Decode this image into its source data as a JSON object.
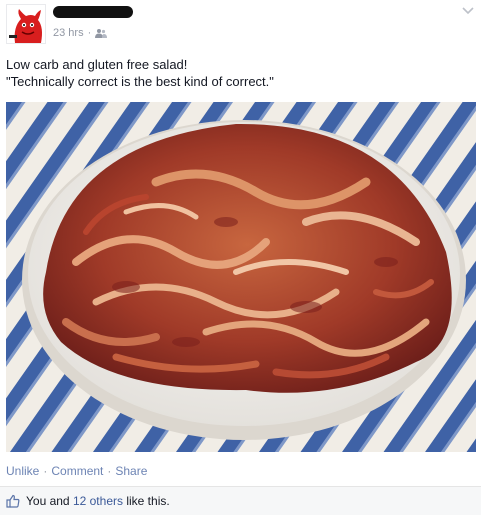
{
  "post": {
    "timestamp": "23 hrs",
    "dot": "·",
    "text_line1": "Low carb and gluten free salad!",
    "text_line2": "\"Technically correct is the best kind of correct.\""
  },
  "actions": {
    "unlike": "Unlike",
    "comment": "Comment",
    "share": "Share",
    "sep": "·"
  },
  "likes": {
    "you_and": "You and",
    "others_link": "12 others",
    "like_this": "like this."
  },
  "icons": {
    "avatar": "red-devil-avatar",
    "audience": "friends-icon",
    "options": "chevron-down-icon",
    "like": "thumbs-up-icon"
  },
  "colors": {
    "link": "#3b5998",
    "action_link": "#6d84b4",
    "meta": "#9197a3"
  }
}
